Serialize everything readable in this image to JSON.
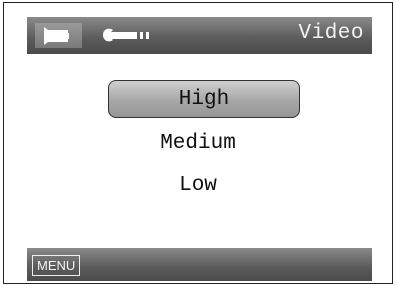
{
  "header": {
    "title": "Video",
    "tabs": [
      {
        "icon": "video-camera-icon",
        "active": true
      },
      {
        "icon": "wrench-icon",
        "active": false
      }
    ]
  },
  "quality_menu": {
    "selected": "High",
    "options": [
      "High",
      "Medium",
      "Low"
    ]
  },
  "footer": {
    "menu_label": "MENU"
  }
}
